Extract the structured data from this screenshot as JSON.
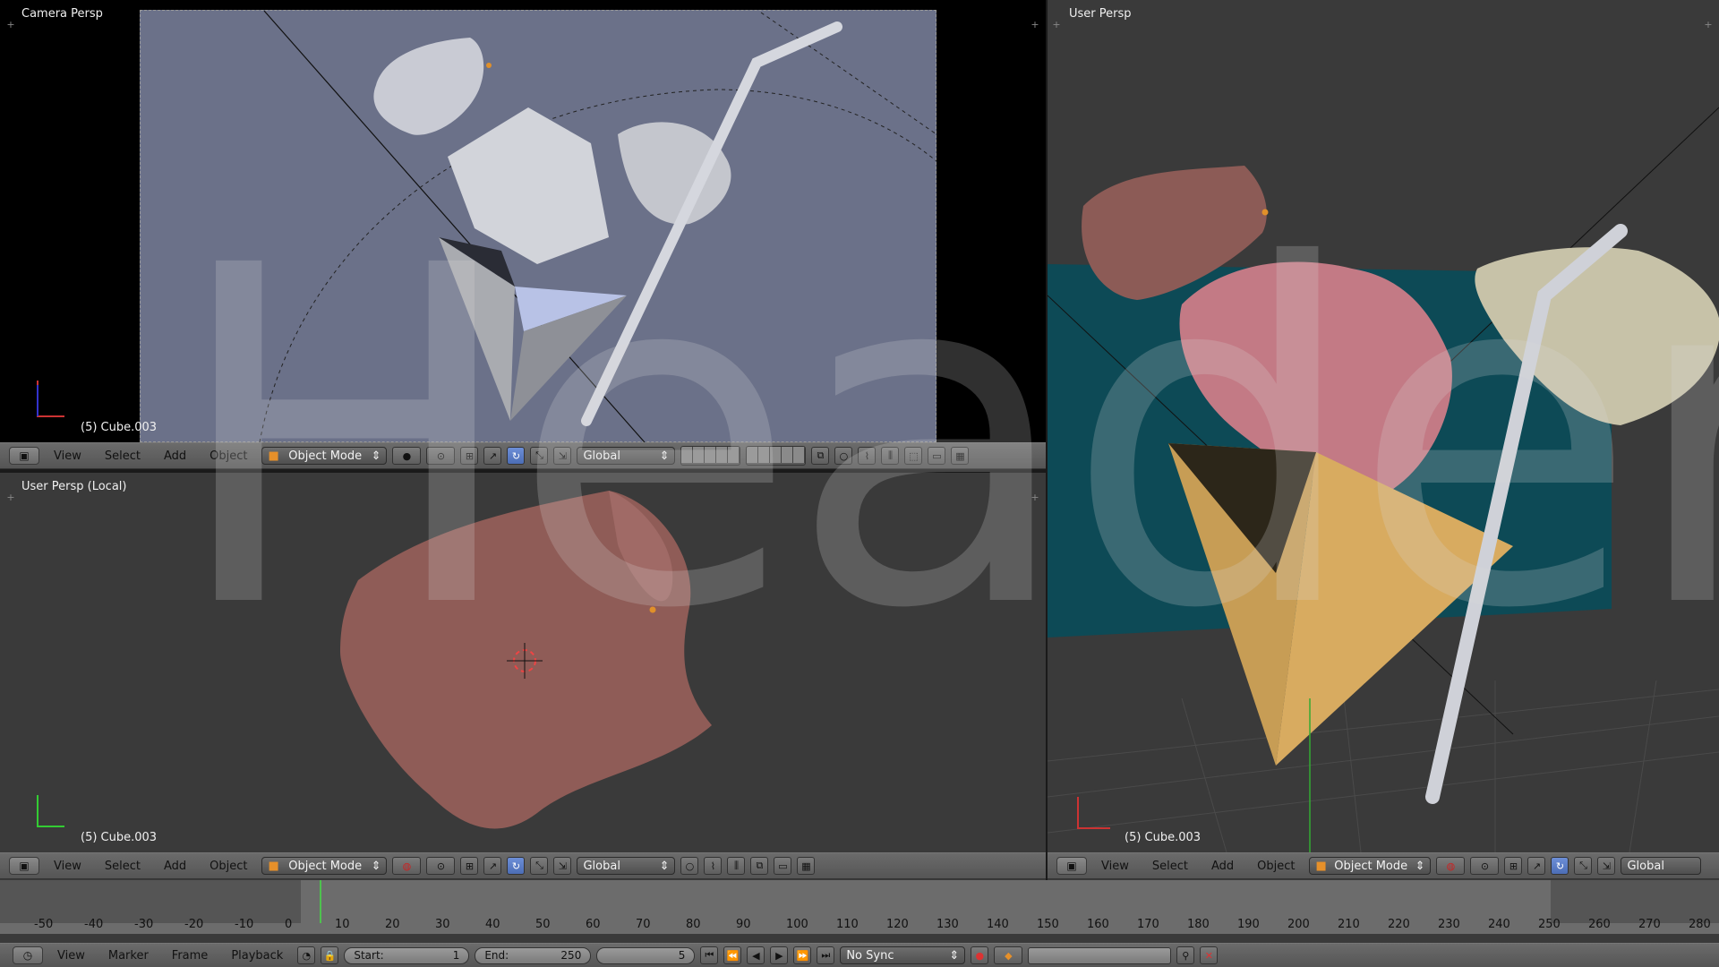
{
  "viewports": {
    "camera": {
      "label": "Camera Persp",
      "object": "(5) Cube.003"
    },
    "local": {
      "label": "User Persp (Local)",
      "object": "(5) Cube.003"
    },
    "user": {
      "label": "User Persp",
      "object": "(5) Cube.003"
    }
  },
  "header_menus": [
    "View",
    "Select",
    "Add",
    "Object"
  ],
  "mode_label": "Object Mode",
  "orientation_label": "Global",
  "timeline": {
    "ticks": [
      "-50",
      "-40",
      "-30",
      "-20",
      "-10",
      "0",
      "10",
      "20",
      "30",
      "40",
      "50",
      "60",
      "70",
      "80",
      "90",
      "100",
      "110",
      "120",
      "130",
      "140",
      "150",
      "160",
      "170",
      "180",
      "190",
      "200",
      "210",
      "220",
      "230",
      "240",
      "250",
      "260",
      "270",
      "280"
    ],
    "current_frame": 5
  },
  "bottom": {
    "menus": [
      "View",
      "Marker",
      "Frame",
      "Playback"
    ],
    "start_label": "Start:",
    "start_value": "1",
    "end_label": "End:",
    "end_value": "250",
    "frame_value": "5",
    "sync_label": "No Sync"
  },
  "watermark": "Headers",
  "colors": {
    "viewport_bg": "#3a3a3a",
    "camera_frame": "#6b7189",
    "accent_blue": "#5b7fd0",
    "record_red": "#d33"
  }
}
